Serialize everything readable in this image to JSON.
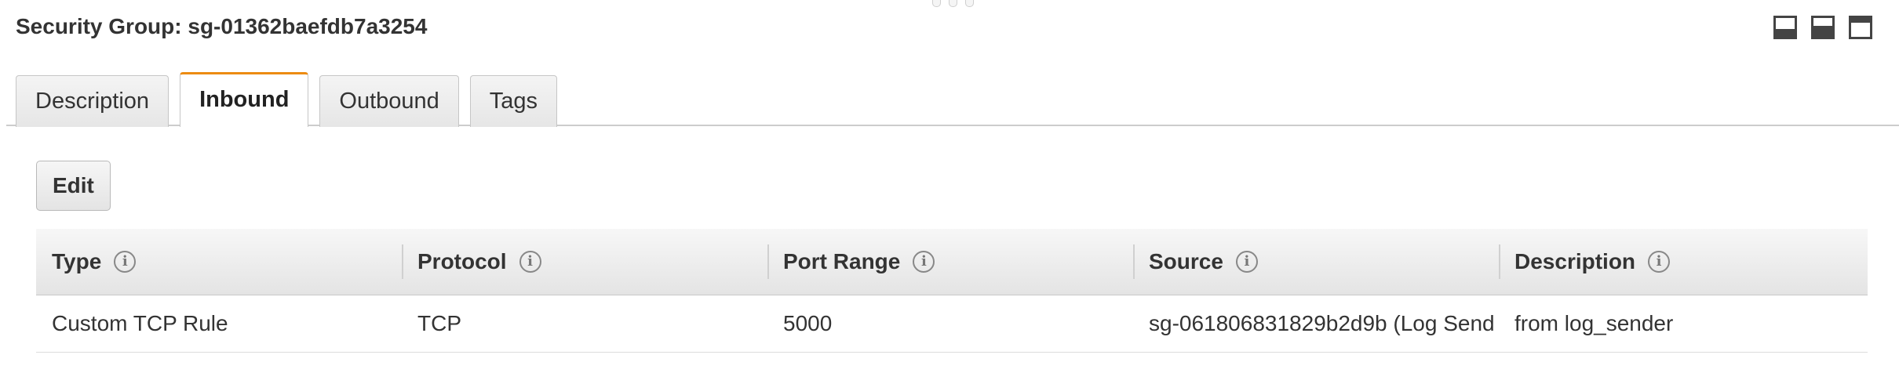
{
  "header": {
    "title": "Security Group: sg-01362baefdb7a3254"
  },
  "tabs": [
    {
      "label": "Description",
      "active": false
    },
    {
      "label": "Inbound",
      "active": true
    },
    {
      "label": "Outbound",
      "active": false
    },
    {
      "label": "Tags",
      "active": false
    }
  ],
  "toolbar": {
    "edit_label": "Edit"
  },
  "table": {
    "columns": [
      "Type",
      "Protocol",
      "Port Range",
      "Source",
      "Description"
    ],
    "info_glyph": "i",
    "rows": [
      [
        "Custom TCP Rule",
        "TCP",
        "5000",
        "sg-061806831829b2d9b (Log Send",
        "from log_sender"
      ]
    ]
  },
  "colors": {
    "active_tab_accent": "#ec8b12"
  },
  "icons": {
    "layout_buttons": [
      "panel-bottom-icon",
      "panel-split-icon",
      "panel-top-icon"
    ],
    "info": "info-icon",
    "drag_handle": "drag-handle-icon"
  }
}
